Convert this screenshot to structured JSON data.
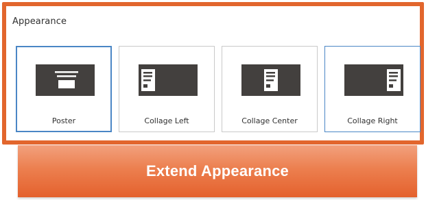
{
  "panel": {
    "title": "Appearance"
  },
  "options": [
    {
      "label": "Poster",
      "icon": "poster-layout-icon",
      "selected": true
    },
    {
      "label": "Collage Left",
      "icon": "collage-left-layout-icon",
      "selected": false
    },
    {
      "label": "Collage Center",
      "icon": "collage-center-layout-icon",
      "selected": false
    },
    {
      "label": "Collage Right",
      "icon": "collage-right-layout-icon",
      "selected": false
    }
  ],
  "cta": {
    "label": "Extend Appearance"
  },
  "colors": {
    "frame_border": "#e2662d",
    "selected_border": "#4a86c5",
    "thumbnail_bg": "#43403e",
    "cta_gradient_top": "#f2a17d",
    "cta_gradient_bottom": "#e4612d"
  }
}
